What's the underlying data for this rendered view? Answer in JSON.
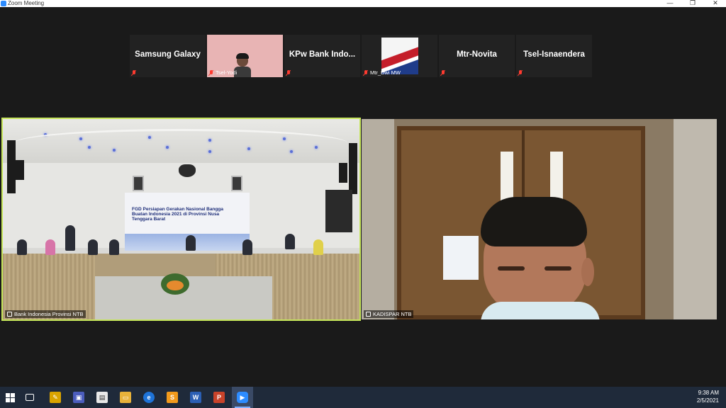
{
  "window": {
    "title": "Zoom Meeting",
    "controls": {
      "minimize": "—",
      "restore": "❐",
      "close": "✕"
    }
  },
  "gallery": [
    {
      "name": "Samsung Galaxy",
      "type": "name"
    },
    {
      "name": "Tsel-Yodi",
      "type": "video"
    },
    {
      "name": "KPw Bank Indo...",
      "type": "name"
    },
    {
      "name": "Mtr_Dwi MW",
      "type": "video"
    },
    {
      "name": "Mtr-Novita",
      "type": "name"
    },
    {
      "name": "Tsel-Isnaendera",
      "type": "name"
    }
  ],
  "main_panes": {
    "left": {
      "label": "Bank Indonesia Provinsi NTB",
      "banner_text": "FGD Persiapan Gerakan Nasional Bangga Buatan Indonesia 2021 di Provinsi Nusa Tenggara Barat",
      "active_speaker_color": "#c6e65a"
    },
    "right": {
      "label": "KADISPAR NTB"
    }
  },
  "taskbar": {
    "icons": [
      {
        "name": "windows-start-icon"
      },
      {
        "name": "task-view-icon"
      },
      {
        "name": "pen-tool-icon"
      },
      {
        "name": "teams-icon"
      },
      {
        "name": "store-icon"
      },
      {
        "name": "file-explorer-icon"
      },
      {
        "name": "edge-icon"
      },
      {
        "name": "sublime-icon"
      },
      {
        "name": "word-icon",
        "glyph": "W"
      },
      {
        "name": "powerpoint-icon",
        "glyph": "P"
      },
      {
        "name": "zoom-icon"
      }
    ],
    "time": "9:38 AM",
    "date": "2/5/2021"
  }
}
